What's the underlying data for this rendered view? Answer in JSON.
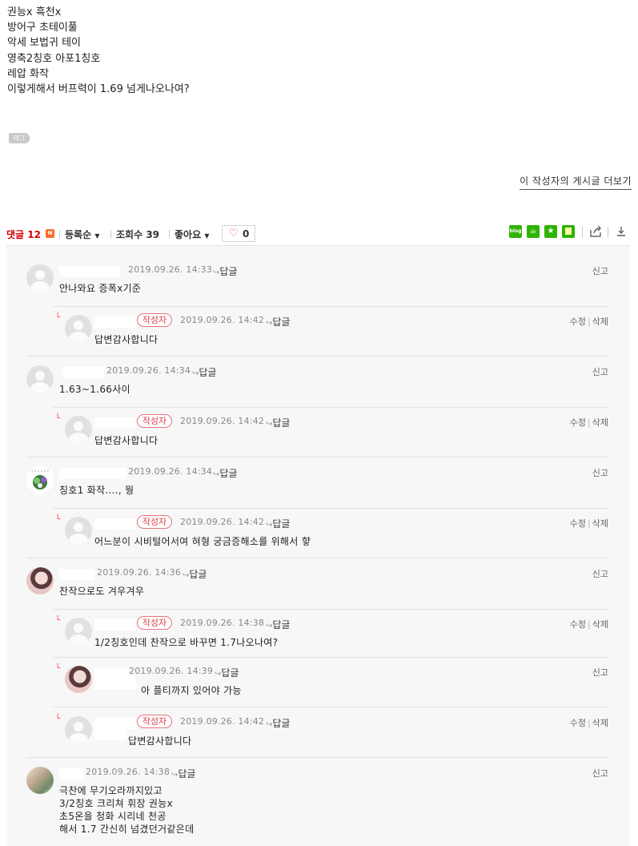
{
  "post": {
    "lines": [
      "권능x 흑천x",
      "방어구 초테이풀",
      "악세 보법귀 테이",
      "영축2칭호 아포1칭호",
      "레압 화작",
      "이렇게해서 버프력이 1.69 넘게나오나여?"
    ],
    "tag_label": "태그",
    "more_posts_label": "이 작성자의 게시글 더보기"
  },
  "comment_bar": {
    "comments_label": "댓글",
    "comments_count": "12",
    "new_badge": "N",
    "sort_label": "등록순",
    "views_label": "조회수",
    "views_count": "39",
    "like_label": "좋아요",
    "like_count": "0",
    "share_icons": [
      "blog-icon",
      "cafe-icon",
      "bookmark-star-icon",
      "memo-icon"
    ],
    "accent_color": "#d40000"
  },
  "labels": {
    "reply": "답글",
    "report": "신고",
    "edit": "수정",
    "delete": "삭제",
    "author": "작성자"
  },
  "comments": [
    {
      "reply": false,
      "time": "2019.09.26. 14:33",
      "text": "안나와요 증폭x기준",
      "own": false
    },
    {
      "reply": true,
      "time": "2019.09.26. 14:42",
      "text": "답변감사합니다",
      "own": true
    },
    {
      "reply": false,
      "time": "2019.09.26. 14:34",
      "text": "1.63~1.66사이",
      "own": false
    },
    {
      "reply": true,
      "time": "2019.09.26. 14:42",
      "text": "답변감사합니다",
      "own": true
    },
    {
      "reply": false,
      "time": "2019.09.26. 14:34",
      "text": "칭호1 화작...., 뭥",
      "own": false
    },
    {
      "reply": true,
      "time": "2019.09.26. 14:42",
      "text": "어느분이 시비털어서여 혀형 궁금증해소를 위해서 햫",
      "own": true
    },
    {
      "reply": false,
      "time": "2019.09.26. 14:36",
      "text": "찬작으로도 겨우겨우",
      "own": false
    },
    {
      "reply": true,
      "time": "2019.09.26. 14:38",
      "text": "1/2칭호인데 찬작으로 바꾸면 1.7나오나여?",
      "own": true
    },
    {
      "reply": true,
      "time": "2019.09.26. 14:39",
      "text": "아 플티까지 있어야 가능",
      "own": false
    },
    {
      "reply": true,
      "time": "2019.09.26. 14:42",
      "text": "답변감사합니다",
      "own": true
    },
    {
      "reply": false,
      "time": "2019.09.26. 14:38",
      "text": "극찬에 무기오라까지있고",
      "own": false
    }
  ],
  "last_comment_extra_lines": [
    "3/2칭호 크리쳐 휘장 권능x",
    "초5온을 청화 시리네 천공",
    "해서 1.7 간신히 넘겼던거같은데"
  ]
}
